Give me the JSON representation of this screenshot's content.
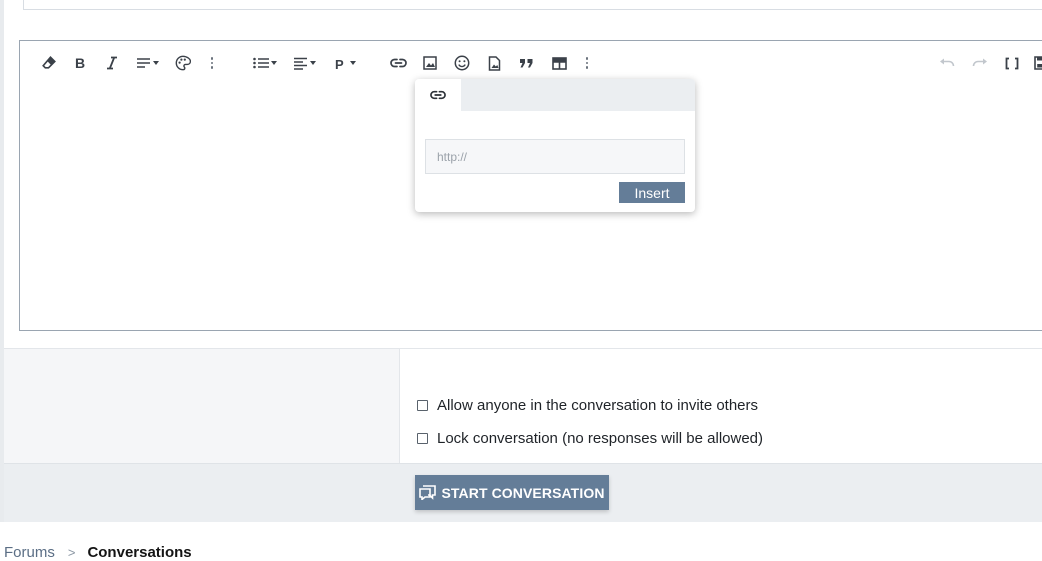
{
  "link_popup": {
    "url_placeholder": "http://",
    "url_value": "",
    "insert_label": "Insert"
  },
  "options": {
    "allow_invite": {
      "label": "Allow anyone in the conversation to invite others",
      "checked": false
    },
    "lock_conversation": {
      "label": "Lock conversation (no responses will be allowed)",
      "checked": false
    }
  },
  "actions": {
    "start_conversation_label": "START CONVERSATION"
  },
  "breadcrumb": {
    "items": [
      "Forums",
      "Conversations"
    ],
    "separator": ">"
  },
  "colors": {
    "button_accent": "#647d98",
    "editor_border": "#9aa5b1",
    "footer_bg": "#ebeef1"
  },
  "toolbar_icons": [
    "clear-formatting-icon",
    "bold-icon",
    "italic-icon",
    "text-align-icon",
    "text-color-icon",
    "more-text-icon",
    "list-icon",
    "alignment-icon",
    "paragraph-format-icon",
    "link-icon",
    "image-icon",
    "emoji-icon",
    "media-icon",
    "quote-icon",
    "table-icon",
    "more-insert-icon",
    "undo-icon",
    "redo-icon",
    "bb-code-icon",
    "save-draft-icon"
  ]
}
